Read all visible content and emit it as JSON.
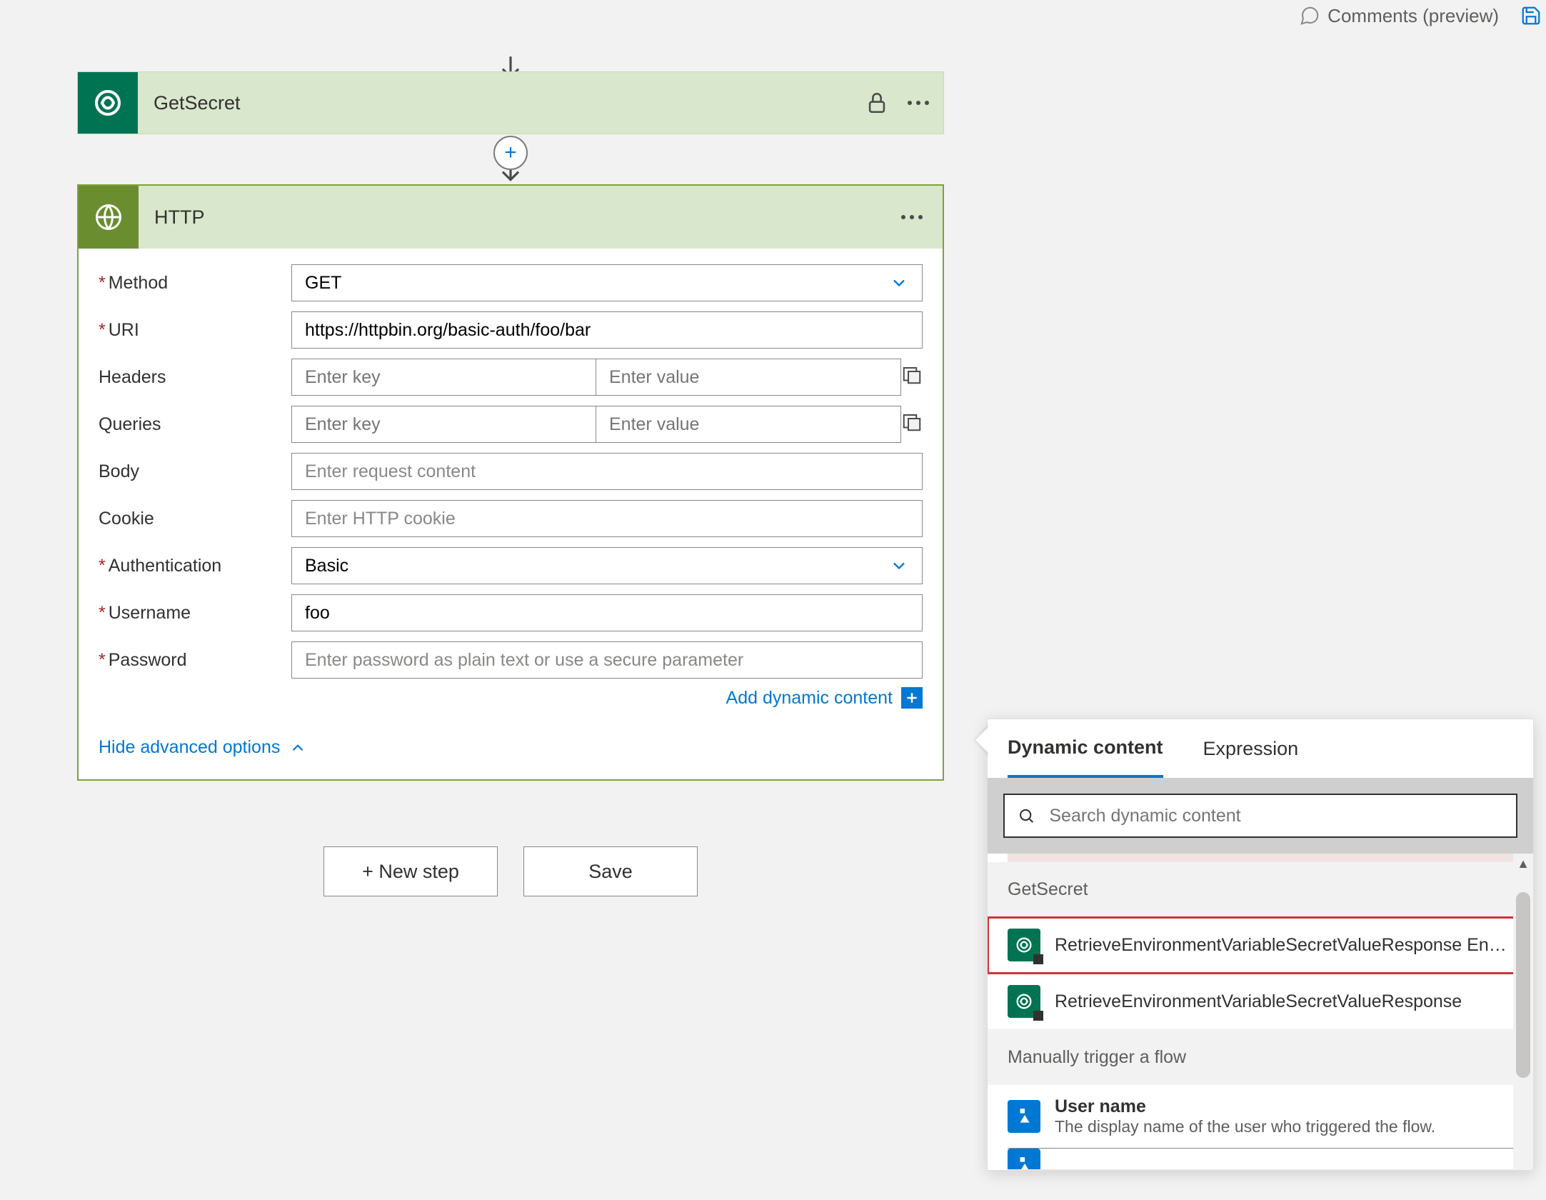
{
  "topbar": {
    "comments_label": "Comments (preview)"
  },
  "steps": {
    "getsecret": {
      "title": "GetSecret"
    },
    "http": {
      "title": "HTTP"
    }
  },
  "http_form": {
    "method": {
      "label": "Method",
      "value": "GET"
    },
    "uri": {
      "label": "URI",
      "value": "https://httpbin.org/basic-auth/foo/bar"
    },
    "headers": {
      "label": "Headers",
      "key_placeholder": "Enter key",
      "value_placeholder": "Enter value"
    },
    "queries": {
      "label": "Queries",
      "key_placeholder": "Enter key",
      "value_placeholder": "Enter value"
    },
    "body": {
      "label": "Body",
      "placeholder": "Enter request content"
    },
    "cookie": {
      "label": "Cookie",
      "placeholder": "Enter HTTP cookie"
    },
    "authentication": {
      "label": "Authentication",
      "value": "Basic"
    },
    "username": {
      "label": "Username",
      "value": "foo"
    },
    "password": {
      "label": "Password",
      "placeholder": "Enter password as plain text or use a secure parameter"
    },
    "add_dynamic_content": "Add dynamic content",
    "hide_advanced": "Hide advanced options"
  },
  "footer": {
    "new_step": "+ New step",
    "save": "Save"
  },
  "dynamic_panel": {
    "tabs": {
      "dynamic": "Dynamic content",
      "expression": "Expression"
    },
    "search_placeholder": "Search dynamic content",
    "groups": {
      "getsecret": "GetSecret",
      "manual": "Manually trigger a flow"
    },
    "items": {
      "retrieve_envi": "RetrieveEnvironmentVariableSecretValueResponse Envi…",
      "retrieve_full": "RetrieveEnvironmentVariableSecretValueResponse",
      "username": "User name",
      "username_desc": "The display name of the user who triggered the flow."
    }
  }
}
